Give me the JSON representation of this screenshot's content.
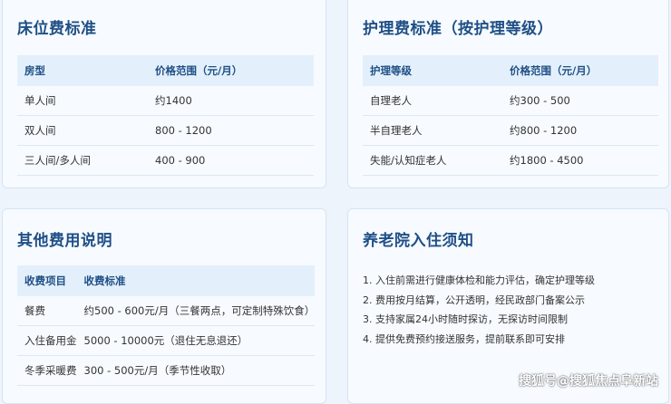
{
  "bed_fees": {
    "title": "床位费标准",
    "headers": [
      "房型",
      "价格范围（元/月）"
    ],
    "rows": [
      [
        "单人间",
        "约1400"
      ],
      [
        "双人间",
        "800 - 1200"
      ],
      [
        "三人间/多人间",
        "400 - 900"
      ]
    ]
  },
  "care_fees": {
    "title": "护理费标准（按护理等级）",
    "headers": [
      "护理等级",
      "价格范围（元/月）"
    ],
    "rows": [
      [
        "自理老人",
        "约300 - 500"
      ],
      [
        "半自理老人",
        "约800 - 1200"
      ],
      [
        "失能/认知症老人",
        "约1800 - 4500"
      ]
    ]
  },
  "other_fees": {
    "title": "其他费用说明",
    "headers": [
      "收费项目",
      "收费标准"
    ],
    "rows": [
      [
        "餐费",
        "约500 - 600元/月（三餐两点，可定制特殊饮食）"
      ],
      [
        "入住备用金",
        "5000 - 10000元（退住无息退还）"
      ],
      [
        "冬季采暖费",
        "300 - 500元/月（季节性收取）"
      ]
    ]
  },
  "notice": {
    "title": "养老院入住须知",
    "items": [
      "1. 入住前需进行健康体检和能力评估，确定护理等级",
      "2. 费用按月结算，公开透明，经民政部门备案公示",
      "3. 支持家属24小时随时探访，无探访时间限制",
      "4. 提供免费预约接送服务，提前联系即可安排"
    ]
  },
  "watermark": "搜狐号@搜狐焦点阜新站",
  "colors": {
    "title": "#1f4f86",
    "header_bg": "#e3f0fb",
    "card_bg": "#f7fbff",
    "page_bg": "#eef4fb"
  }
}
